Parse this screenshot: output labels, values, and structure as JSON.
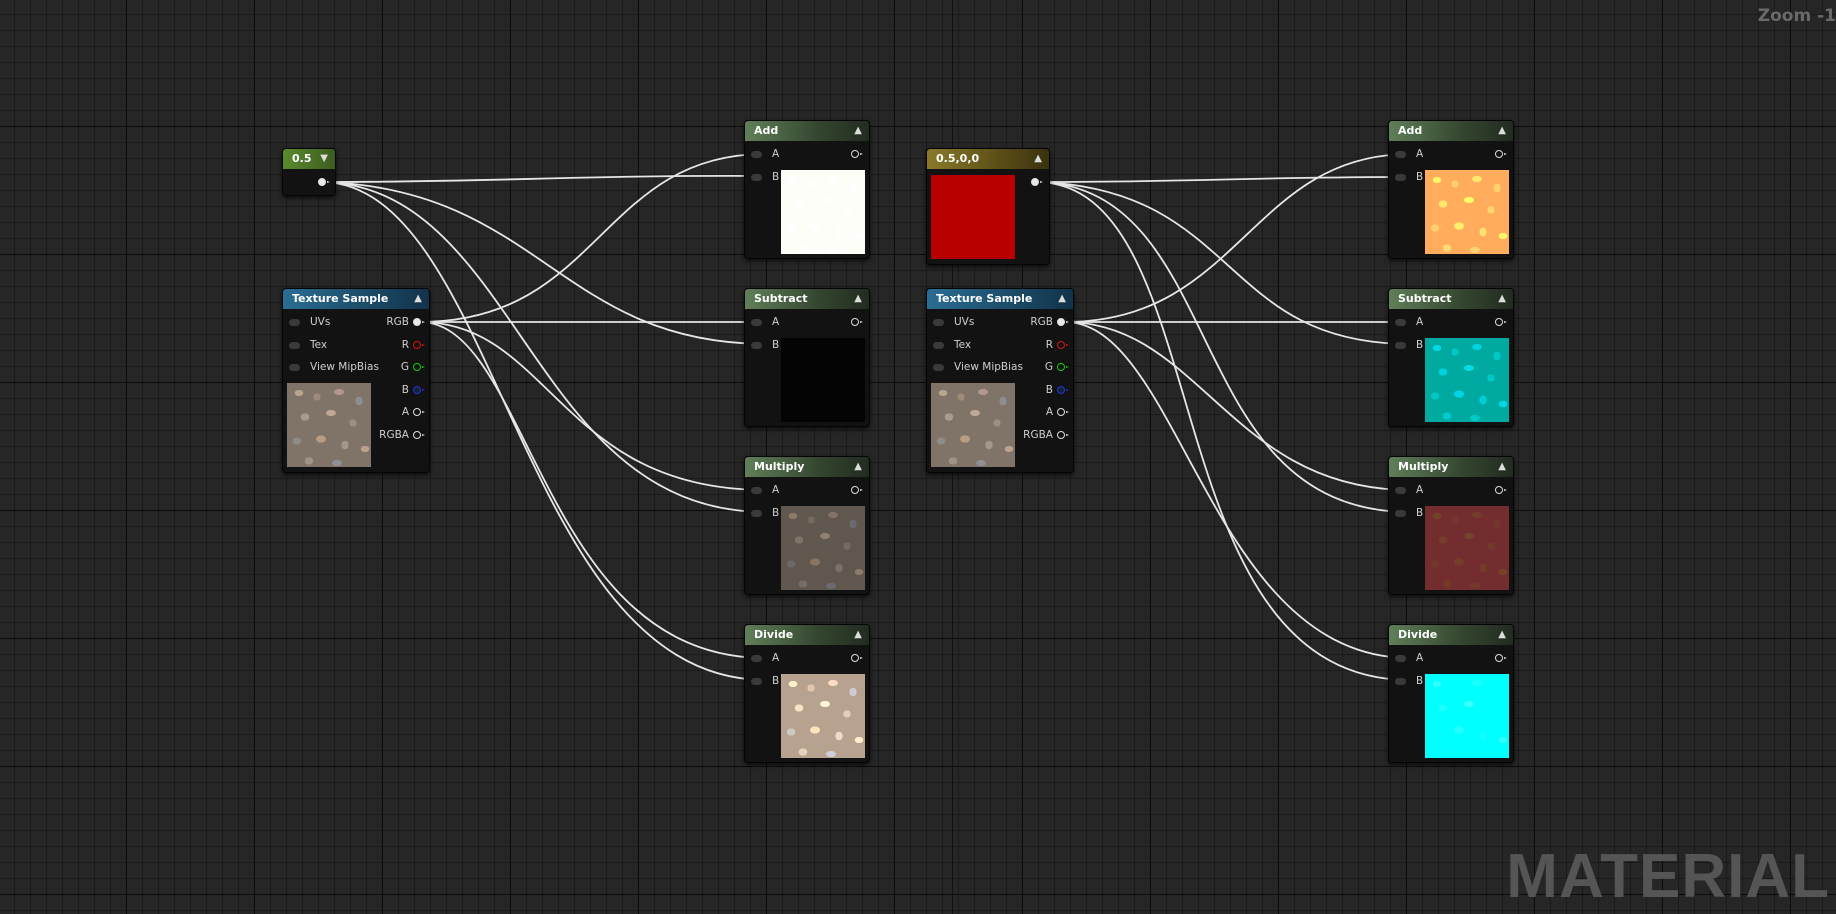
{
  "zoom_label": "Zoom -1",
  "watermark": "MATERIAL",
  "colors": {
    "wire": "#e6e6e6",
    "background": "#262626",
    "pin_red": "#dd1111",
    "pin_green": "#11cc11",
    "pin_blue": "#2233dd",
    "vector_swatch": "#b80000"
  },
  "left_graph": {
    "constant": {
      "title": "0.5",
      "icon": "collapse-arrow-icon"
    },
    "texture_sample": {
      "title": "Texture Sample",
      "inputs": [
        "UVs",
        "Tex",
        "View MipBias"
      ],
      "outputs": [
        "RGB",
        "R",
        "G",
        "B",
        "A",
        "RGBA"
      ]
    },
    "ops": [
      {
        "title": "Add",
        "inputs": [
          "A",
          "B"
        ]
      },
      {
        "title": "Subtract",
        "inputs": [
          "A",
          "B"
        ]
      },
      {
        "title": "Multiply",
        "inputs": [
          "A",
          "B"
        ]
      },
      {
        "title": "Divide",
        "inputs": [
          "A",
          "B"
        ]
      }
    ]
  },
  "right_graph": {
    "constant": {
      "title": "0.5,0,0"
    },
    "texture_sample": {
      "title": "Texture Sample",
      "inputs": [
        "UVs",
        "Tex",
        "View MipBias"
      ],
      "outputs": [
        "RGB",
        "R",
        "G",
        "B",
        "A",
        "RGBA"
      ]
    },
    "ops": [
      {
        "title": "Add",
        "inputs": [
          "A",
          "B"
        ]
      },
      {
        "title": "Subtract",
        "inputs": [
          "A",
          "B"
        ]
      },
      {
        "title": "Multiply",
        "inputs": [
          "A",
          "B"
        ]
      },
      {
        "title": "Divide",
        "inputs": [
          "A",
          "B"
        ]
      }
    ]
  }
}
